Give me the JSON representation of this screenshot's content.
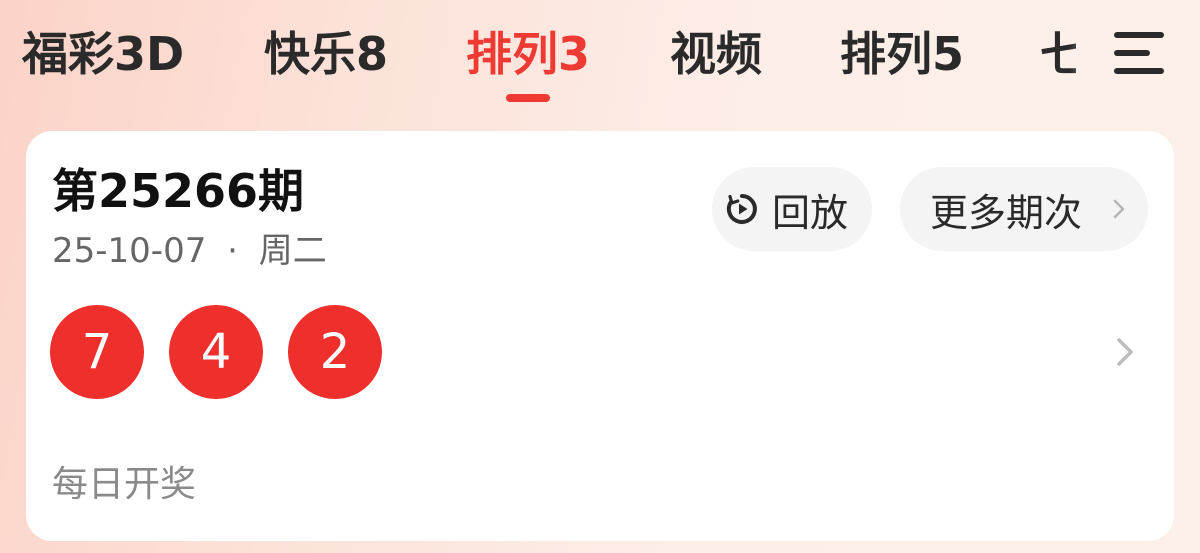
{
  "tabs": [
    {
      "label": "福彩3D",
      "active": false
    },
    {
      "label": "快乐8",
      "active": false
    },
    {
      "label": "排列3",
      "active": true
    },
    {
      "label": "视频",
      "active": false
    },
    {
      "label": "排列5",
      "active": false
    },
    {
      "label": "七",
      "active": false
    }
  ],
  "menu": {
    "icon": "menu-icon"
  },
  "card": {
    "issue": "第25266期",
    "date": "25-10-07",
    "weekday": "周二",
    "separator": "·",
    "replay_label": "回放",
    "replay_icon": "replay-play-icon",
    "more_label": "更多期次",
    "more_icon": "chevron-right-icon",
    "numbers": [
      "7",
      "4",
      "2"
    ],
    "row_icon": "chevron-right-icon",
    "schedule": "每日开奖"
  },
  "colors": {
    "accent": "#ee3a33",
    "ball": "#ee2f2b",
    "text_primary": "#111111",
    "text_secondary": "#666666"
  }
}
